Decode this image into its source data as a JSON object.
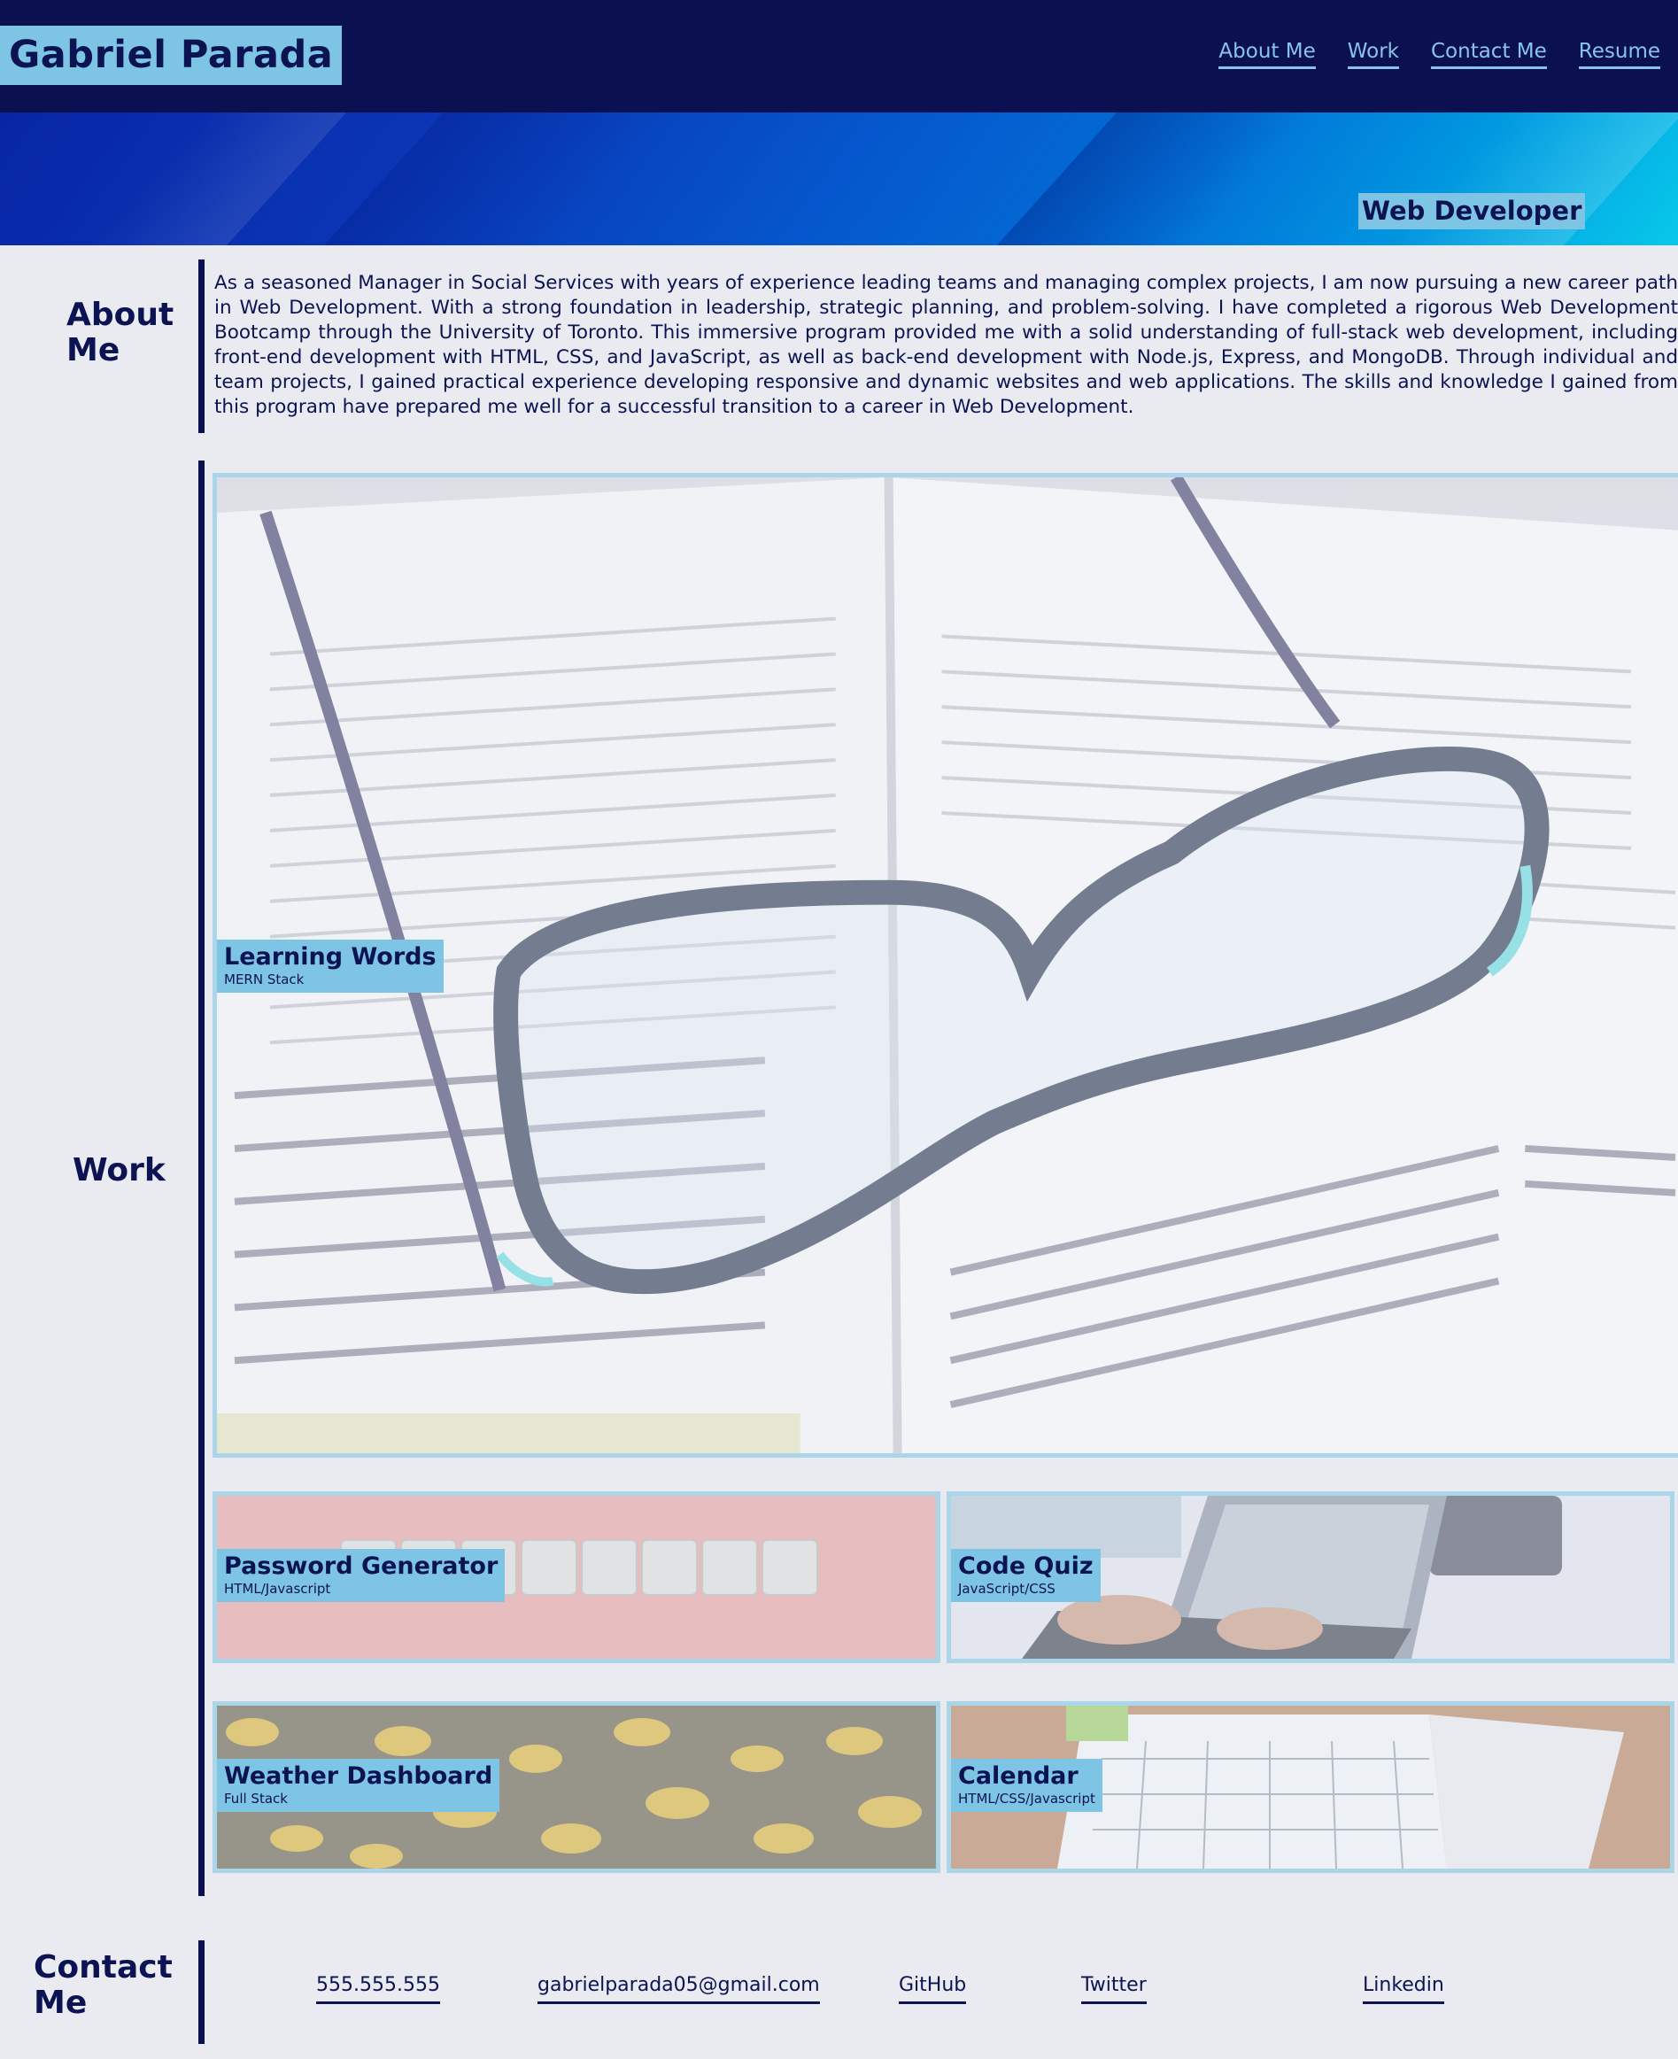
{
  "header": {
    "site_title": "Gabriel Parada",
    "nav": [
      {
        "label": "About Me"
      },
      {
        "label": "Work"
      },
      {
        "label": "Contact Me"
      },
      {
        "label": "Resume"
      }
    ]
  },
  "hero": {
    "role": "Web Developer"
  },
  "about": {
    "title": "About Me",
    "text": "As a seasoned Manager in Social Services with years of experience leading teams and managing complex projects, I am now pursuing a new career path in Web Development. With a strong foundation in leadership, strategic planning, and problem-solving. I have completed a rigorous Web Development Bootcamp through the University of Toronto. This immersive program provided me with a solid understanding of full-stack web development, including front-end development with HTML, CSS, and JavaScript, as well as back-end development with Node.js, Express, and MongoDB. Through individual and team projects, I gained practical experience developing responsive and dynamic websites and web applications. The skills and knowledge I gained from this program have prepared me well for a successful transition to a career in Web Development."
  },
  "work": {
    "title": "Work",
    "projects": [
      {
        "title": "Learning Words",
        "stack": "MERN Stack"
      },
      {
        "title": "Password Generator",
        "stack": "HTML/Javascript"
      },
      {
        "title": "Code Quiz",
        "stack": "JavaScript/CSS"
      },
      {
        "title": "Weather Dashboard",
        "stack": "Full Stack"
      },
      {
        "title": "Calendar",
        "stack": "HTML/CSS/Javascript"
      }
    ]
  },
  "contact": {
    "title": "Contact Me",
    "links": [
      {
        "label": "555.555.555"
      },
      {
        "label": "gabrielparada05@gmail.com"
      },
      {
        "label": "GitHub"
      },
      {
        "label": "Twitter"
      },
      {
        "label": "Linkedin"
      }
    ]
  },
  "colors": {
    "navy": "#0b1150",
    "accent_blue": "#7ec4e4",
    "page_bg": "#eaebf1",
    "card_border": "#abd6ea"
  }
}
